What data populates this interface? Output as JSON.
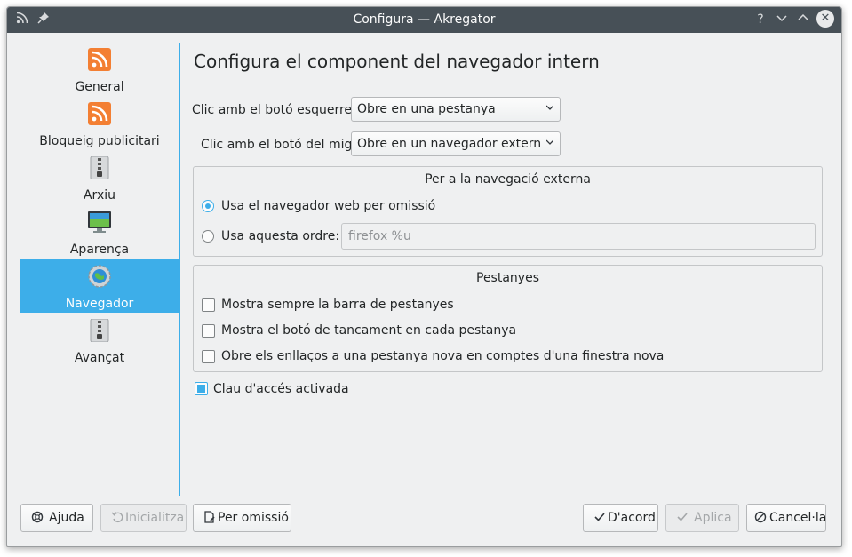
{
  "window": {
    "title": "Configura — Akregator"
  },
  "sidebar": {
    "items": [
      {
        "label": "General",
        "icon": "rss-feed-icon"
      },
      {
        "label": "Bloqueig publicitari",
        "icon": "rss-feed-icon"
      },
      {
        "label": "Arxiu",
        "icon": "archive-zip-icon"
      },
      {
        "label": "Aparença",
        "icon": "monitor-icon"
      },
      {
        "label": "Navegador",
        "icon": "globe-gear-icon",
        "selected": true
      },
      {
        "label": "Avançat",
        "icon": "archive-zip-icon"
      }
    ]
  },
  "main": {
    "title": "Configura el component del navegador intern",
    "left_click_label": "Clic amb el botó esquerre:",
    "left_click_value": "Obre en una pestanya",
    "middle_click_label": "Clic amb el botó del mig:",
    "middle_click_value": "Obre en un navegador extern",
    "external": {
      "title": "Per a la navegació externa",
      "option_default": "Usa el navegador web per omissió",
      "option_command": "Usa aquesta ordre:",
      "command_value": "firefox %u",
      "selected": "default"
    },
    "tabs": {
      "title": "Pestanyes",
      "options": [
        {
          "label": "Mostra sempre la barra de pestanyes",
          "checked": false
        },
        {
          "label": "Mostra el botó de tancament en cada pestanya",
          "checked": false
        },
        {
          "label": "Obre els enllaços a una pestanya nova en comptes d'una finestra nova",
          "checked": false
        }
      ]
    },
    "access_key": {
      "label": "Clau d'accés activada",
      "checked": true
    }
  },
  "buttons": {
    "help": "Ajuda",
    "reset": "Inicialitza",
    "defaults": "Per omissió",
    "ok": "D'acord",
    "apply": "Aplica",
    "cancel": "Cancel·la"
  },
  "colors": {
    "accent": "#3daee9",
    "titlebar": "#475057",
    "rss": "#f37f33"
  }
}
